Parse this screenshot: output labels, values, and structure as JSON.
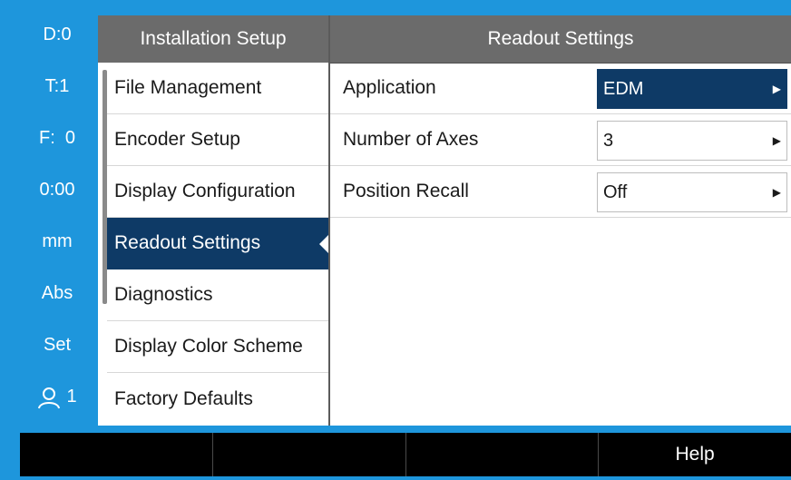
{
  "status_bar": {
    "items": [
      {
        "label": "D:0"
      },
      {
        "label": "T:1"
      },
      {
        "label": "F:  0"
      },
      {
        "label": "0:00"
      },
      {
        "label": "mm"
      },
      {
        "label": "Abs"
      },
      {
        "label": "Set"
      },
      {
        "label": "1",
        "icon": "user-icon"
      }
    ]
  },
  "menu": {
    "title": "Installation Setup",
    "items": [
      {
        "label": "File Management"
      },
      {
        "label": "Encoder Setup"
      },
      {
        "label": "Display Configuration"
      },
      {
        "label": "Readout Settings",
        "selected": true
      },
      {
        "label": "Diagnostics"
      },
      {
        "label": "Display Color Scheme"
      },
      {
        "label": "Factory Defaults"
      }
    ]
  },
  "settings": {
    "title": "Readout Settings",
    "rows": [
      {
        "label": "Application",
        "value": "EDM",
        "active": true
      },
      {
        "label": "Number of Axes",
        "value": "3"
      },
      {
        "label": "Position Recall",
        "value": "Off"
      }
    ]
  },
  "softkeys": [
    {
      "label": ""
    },
    {
      "label": ""
    },
    {
      "label": ""
    },
    {
      "label": "Help"
    }
  ],
  "colors": {
    "frame": "#1e96dc",
    "header": "#6b6b6b",
    "selected": "#0e3a66",
    "softkey_bar": "#000000"
  }
}
